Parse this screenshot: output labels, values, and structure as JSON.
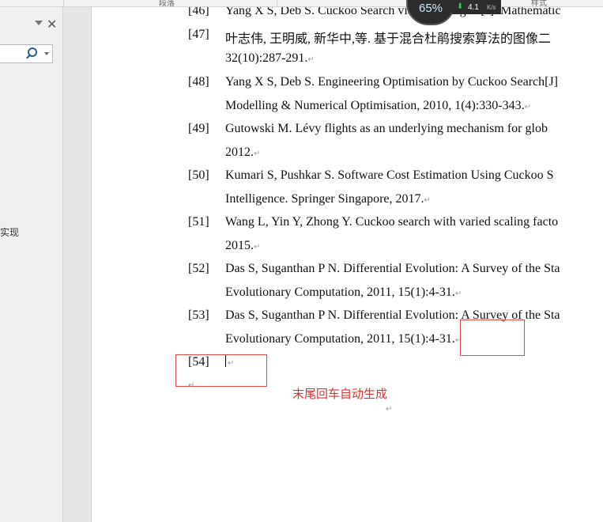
{
  "ribbon": {
    "group1": "段落",
    "group2": "样式"
  },
  "nav": {
    "heading_partial": "实现"
  },
  "widget": {
    "percent": "65%",
    "speed_value": "4.1",
    "speed_unit": "K/s"
  },
  "references": [
    {
      "num": "[46]",
      "lines": [
        "Yang X S, Deb S. Cuckoo Search via Lévy Flights[J]. Mathematic"
      ]
    },
    {
      "num": "[47]",
      "lines": [
        "叶志伟, 王明威, 新华中,等. 基于混合杜鹃搜索算法的图像二",
        "32(10):287-291."
      ]
    },
    {
      "num": "[48]",
      "lines": [
        "Yang X S, Deb S. Engineering Optimisation by Cuckoo Search[J]",
        "Modelling & Numerical Optimisation, 2010, 1(4):330-343."
      ]
    },
    {
      "num": "[49]",
      "lines": [
        "Gutowski M. Lévy flights as an underlying mechanism for glob",
        "2012."
      ]
    },
    {
      "num": "[50]",
      "lines": [
        "Kumari S, Pushkar S. Software Cost Estimation Using Cuckoo S",
        "Intelligence. Springer Singapore, 2017."
      ]
    },
    {
      "num": "[51]",
      "lines": [
        "Wang L, Yin Y, Zhong Y. Cuckoo search with varied scaling facto",
        "2015."
      ]
    },
    {
      "num": "[52]",
      "lines": [
        "Das S, Suganthan P N. Differential Evolution: A Survey of the Sta",
        "Evolutionary Computation, 2011, 15(1):4-31."
      ]
    },
    {
      "num": "[53]",
      "lines": [
        "Das S, Suganthan P N. Differential Evolution: A Survey of the Sta",
        "Evolutionary Computation, 2011, 15(1):4-31."
      ]
    },
    {
      "num": "[54]",
      "lines": [
        ""
      ]
    }
  ],
  "annotation": {
    "text": "末尾回车自动生成"
  },
  "para_mark": "↵"
}
